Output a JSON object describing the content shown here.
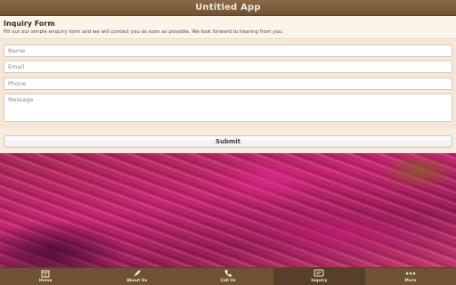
{
  "app": {
    "title": "Untitled App"
  },
  "form": {
    "heading": "Inquiry Form",
    "description": "Fill out our simple enquiry form and we will contact you as soon as possible. We look forward to hearing from you.",
    "fields": {
      "name_placeholder": "Name",
      "email_placeholder": "Email",
      "phone_placeholder": "Phone",
      "message_placeholder": "Message"
    },
    "submit_label": "Submit"
  },
  "tabbar": {
    "items": [
      {
        "label": "Home",
        "icon": "home-icon",
        "active": false
      },
      {
        "label": "About Us",
        "icon": "feather-icon",
        "active": false
      },
      {
        "label": "Call Us",
        "icon": "phone-icon",
        "active": false
      },
      {
        "label": "Inquiry",
        "icon": "inquiry-icon",
        "active": true
      },
      {
        "label": "More",
        "icon": "more-icon",
        "active": false
      }
    ]
  },
  "colors": {
    "header": "#6f5134",
    "panel": "#f7ecde",
    "tab_active": "#57402a"
  }
}
